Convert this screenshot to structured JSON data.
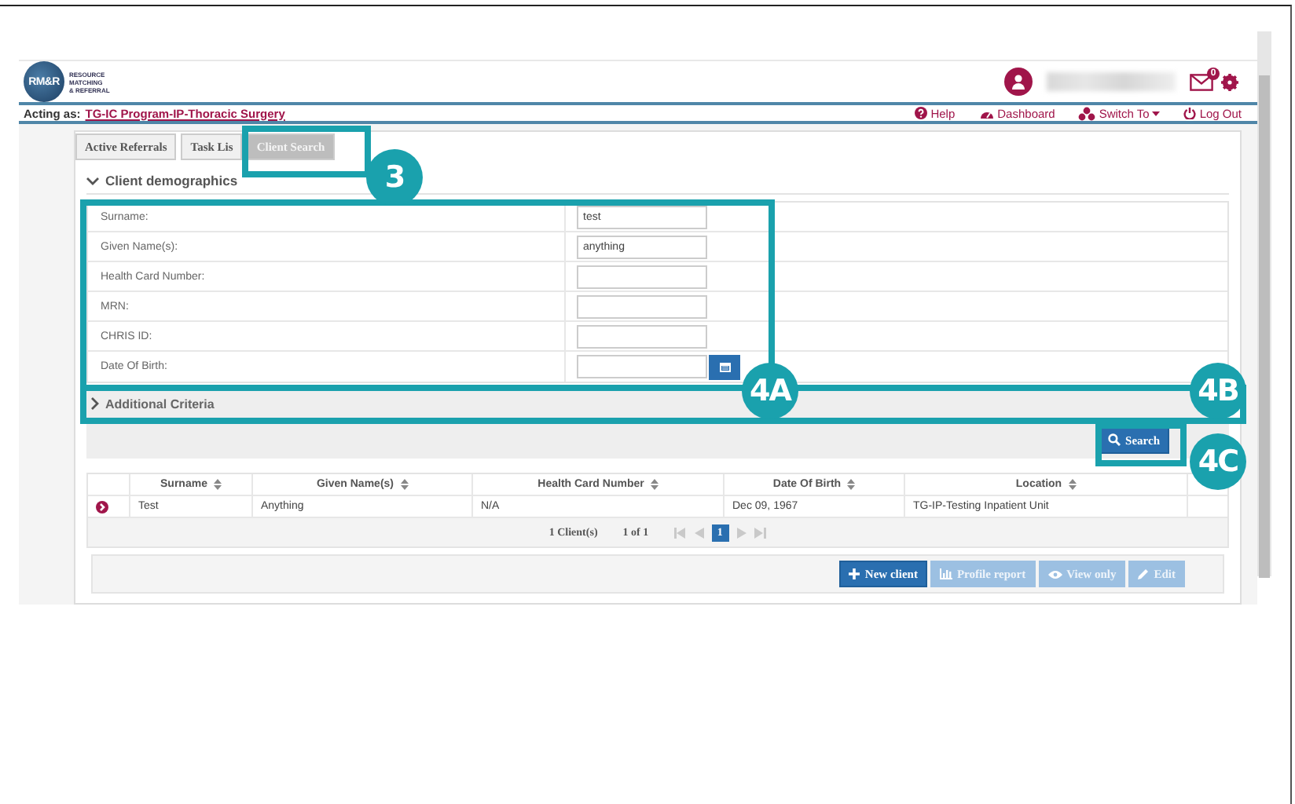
{
  "header": {
    "logo_text": "RM&R",
    "logo_caption": [
      "RESOURCE",
      "MATCHING",
      "& REFERRAL"
    ],
    "mail_count": "0"
  },
  "acting_as": {
    "label": "Acting as:",
    "program": "TG-IC Program-IP-Thoracic Surgery"
  },
  "nav_links": [
    {
      "label": "Help",
      "kind": "help"
    },
    {
      "label": "Dashboard",
      "kind": "dashboard"
    },
    {
      "label": "Switch To",
      "kind": "switch"
    },
    {
      "label": "Log Out",
      "kind": "logout"
    }
  ],
  "tabs": [
    {
      "label": "Active Referrals",
      "selected": false
    },
    {
      "label": "Task Lis",
      "selected": false
    },
    {
      "label": "Client Search",
      "selected": true
    }
  ],
  "demographics": {
    "title": "Client demographics",
    "expanded": true
  },
  "fields": [
    {
      "label": "Surname:",
      "value": "test",
      "kind": "text"
    },
    {
      "label": "Given Name(s):",
      "value": "anything",
      "kind": "text"
    },
    {
      "label": "Health Card Number:",
      "kind": "text"
    },
    {
      "label": "MRN:",
      "kind": "text"
    },
    {
      "label": "CHRIS ID:",
      "kind": "text"
    },
    {
      "label": "Date Of Birth:",
      "kind": "date"
    }
  ],
  "additional_criteria": {
    "title": "Additional Criteria",
    "expanded": false
  },
  "search_button": "Search",
  "results": {
    "columns": [
      "Surname",
      "Given Name(s)",
      "Health Card Number",
      "Date Of Birth",
      "Location"
    ],
    "rows": [
      {
        "cells": [
          "Test",
          "Anything",
          "N/A",
          "Dec 09, 1967",
          "TG-IP-Testing Inpatient Unit"
        ]
      }
    ],
    "count": "1 Client(s)",
    "page_info": "1 of 1",
    "pages": [
      {
        "label": "1",
        "selected": true
      }
    ]
  },
  "actions": [
    {
      "label": "New client",
      "kind": "new",
      "disabled": false
    },
    {
      "label": "Profile report",
      "kind": "report",
      "disabled": true
    },
    {
      "label": "View only",
      "kind": "view",
      "disabled": true
    },
    {
      "label": "Edit",
      "kind": "edit",
      "disabled": true
    }
  ],
  "callouts": [
    {
      "label": "3"
    },
    {
      "label": "4A"
    },
    {
      "label": "4B"
    },
    {
      "label": "4C"
    }
  ]
}
